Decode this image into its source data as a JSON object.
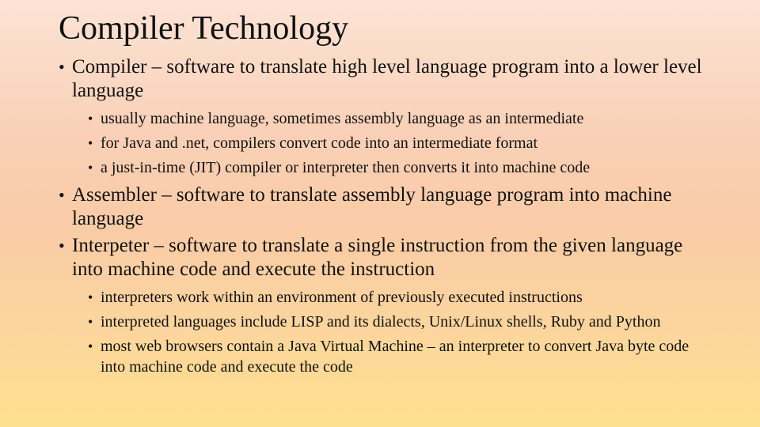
{
  "slide": {
    "title": "Compiler Technology",
    "bullets": [
      {
        "text": "Compiler – software to translate high level language program into a lower level language",
        "sub": [
          "usually  machine language, sometimes assembly language as an intermediate",
          "for Java and .net, compilers convert code into an intermediate format",
          "a just-in-time (JIT) compiler or interpreter then converts it into machine code"
        ]
      },
      {
        "text": "Assembler – software to translate assembly language program into machine language",
        "sub": []
      },
      {
        "text": "Interpeter – software to translate a single instruction from the given language into machine code and execute the instruction",
        "sub": [
          "interpreters work within an environment of previously executed instructions",
          "interpreted languages include LISP and its dialects, Unix/Linux shells, Ruby and Python",
          "most web browsers contain a Java Virtual Machine – an interpreter to convert Java byte code into machine code and execute the code"
        ]
      }
    ]
  },
  "colors": {
    "background_top": "#fce3d5",
    "background_middle": "#f9cba8",
    "background_bottom": "#fee18e",
    "text": "#111111"
  }
}
